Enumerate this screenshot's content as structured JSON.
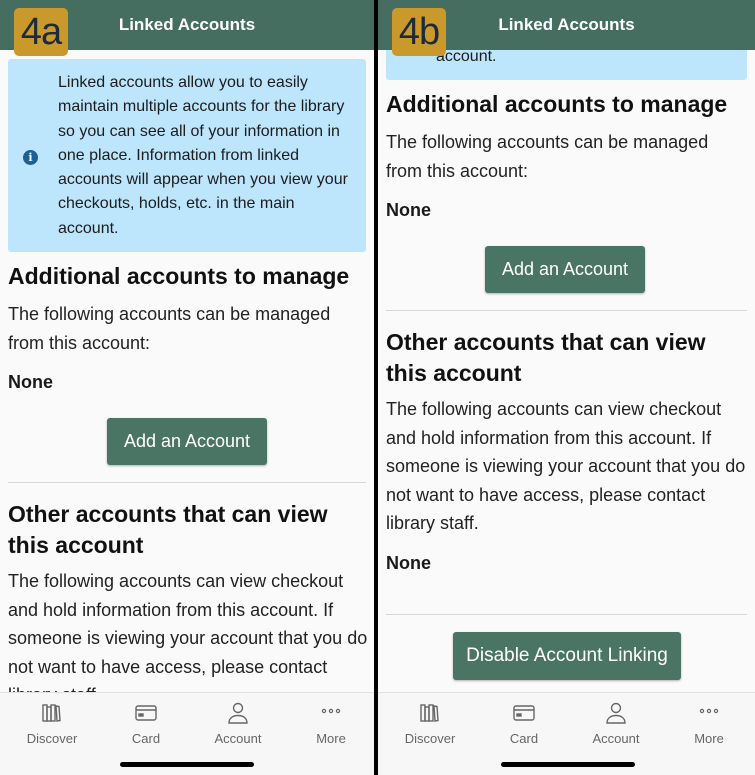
{
  "header": {
    "title": "Linked Accounts"
  },
  "badges": {
    "a": "4a",
    "b": "4b"
  },
  "info": {
    "text": "Linked accounts allow you to easily maintain multiple accounts for the library so you can see all of your information in one place. Information from linked accounts will appear when you view your checkouts, holds, etc. in the main account.",
    "icon": "info-icon"
  },
  "manage": {
    "heading": "Additional accounts to manage",
    "description": "The following accounts can be managed from this account:",
    "value": "None",
    "button": "Add an Account"
  },
  "viewers": {
    "heading": "Other accounts that can view this account",
    "description": "The following accounts can view checkout and hold information from this account. If someone is viewing your account that you do not want to have access, please contact library staff.",
    "value": "None"
  },
  "disable_button": "Disable Account Linking",
  "tabs": [
    {
      "label": "Discover",
      "icon": "books-icon"
    },
    {
      "label": "Card",
      "icon": "card-icon"
    },
    {
      "label": "Account",
      "icon": "person-icon"
    },
    {
      "label": "More",
      "icon": "ellipsis-icon"
    }
  ],
  "colors": {
    "header": "#456e60",
    "button": "#4a7565",
    "info_bg": "#bde5fb",
    "badge": "#c99a2b"
  }
}
